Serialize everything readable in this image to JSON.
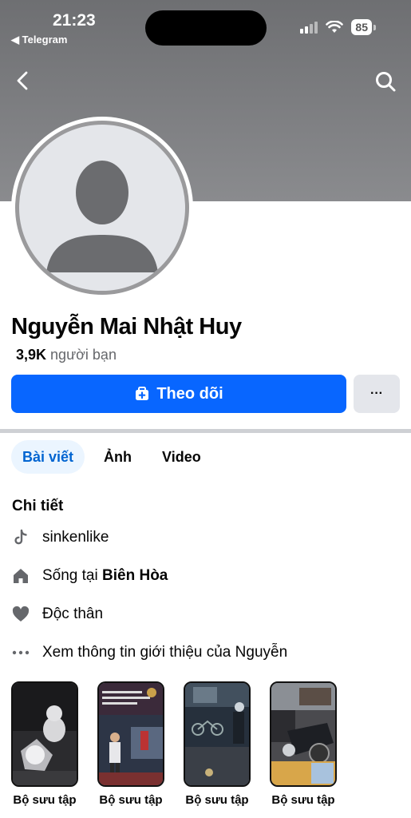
{
  "status_bar": {
    "time": "21:23",
    "back_app": "◀ Telegram",
    "battery": "85"
  },
  "profile": {
    "name": "Nguyễn Mai Nhật Huy",
    "friends_count": "3,9K",
    "friends_label": "người bạn"
  },
  "actions": {
    "follow_label": "Theo dõi",
    "more_label": "···"
  },
  "tabs": [
    {
      "label": "Bài viết",
      "active": true
    },
    {
      "label": "Ảnh",
      "active": false
    },
    {
      "label": "Video",
      "active": false
    }
  ],
  "details": {
    "title": "Chi tiết",
    "tiktok": "sinkenlike",
    "lives_in_prefix": "Sống tại",
    "lives_in_place": "Biên Hòa",
    "relationship": "Độc thân",
    "see_about": "Xem thông tin giới thiệu của Nguyễn"
  },
  "collections": [
    {
      "label": "Bộ sưu tập"
    },
    {
      "label": "Bộ sưu tập"
    },
    {
      "label": "Bộ sưu tập"
    },
    {
      "label": "Bộ sưu tập"
    }
  ],
  "colors": {
    "accent": "#0866ff",
    "cover": "#7d7e81",
    "active_tab_bg": "#ebf5ff"
  }
}
